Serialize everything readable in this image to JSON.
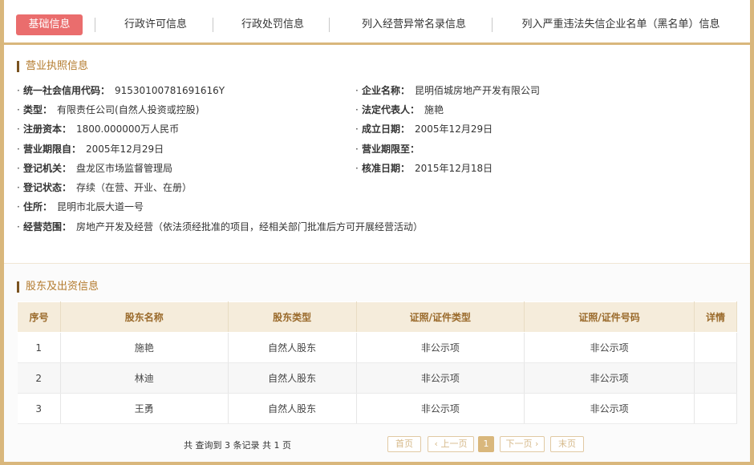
{
  "tabs": [
    {
      "label": "基础信息",
      "active": true
    },
    {
      "label": "行政许可信息",
      "active": false
    },
    {
      "label": "行政处罚信息",
      "active": false
    },
    {
      "label": "列入经营异常名录信息",
      "active": false
    },
    {
      "label": "列入严重违法失信企业名单（黑名单）信息",
      "active": false
    }
  ],
  "license": {
    "title": "营业执照信息",
    "credit_code_label": "统一社会信用代码：",
    "credit_code": "91530100781691616Y",
    "company_name_label": "企业名称：",
    "company_name": "昆明佰城房地产开发有限公司",
    "type_label": "类型：",
    "type": "有限责任公司(自然人投资或控股)",
    "legal_rep_label": "法定代表人：",
    "legal_rep": "施艳",
    "capital_label": "注册资本：",
    "capital": "1800.000000万人民币",
    "founded_label": "成立日期：",
    "founded": "2005年12月29日",
    "term_from_label": "营业期限自：",
    "term_from": "2005年12月29日",
    "term_to_label": "营业期限至：",
    "term_to": "",
    "authority_label": "登记机关：",
    "authority": "盘龙区市场监督管理局",
    "approved_label": "核准日期：",
    "approved": "2015年12月18日",
    "status_label": "登记状态：",
    "status": "存续（在营、开业、在册）",
    "address_label": "住所：",
    "address": "昆明市北辰大道一号",
    "scope_label": "经营范围：",
    "scope": "房地产开发及经营（依法须经批准的项目，经相关部门批准后方可开展经营活动）"
  },
  "shareholders": {
    "title": "股东及出资信息",
    "columns": [
      "序号",
      "股东名称",
      "股东类型",
      "证照/证件类型",
      "证照/证件号码",
      "详情"
    ],
    "rows": [
      [
        "1",
        "施艳",
        "自然人股东",
        "非公示项",
        "非公示项",
        ""
      ],
      [
        "2",
        "林迪",
        "自然人股东",
        "非公示项",
        "非公示项",
        ""
      ],
      [
        "3",
        "王勇",
        "自然人股东",
        "非公示项",
        "非公示项",
        ""
      ]
    ]
  },
  "pager": {
    "info": "共 查询到 3 条记录 共 1 页",
    "first": "首页",
    "prev": "‹ 上一页",
    "current": "1",
    "next": "下一页 ›",
    "last": "末页"
  },
  "colors": {
    "accent_border": "#d9b77c",
    "active_tab": "#ea6d6d",
    "heading": "#b37a2c",
    "table_header_bg": "#f5ecdb"
  }
}
